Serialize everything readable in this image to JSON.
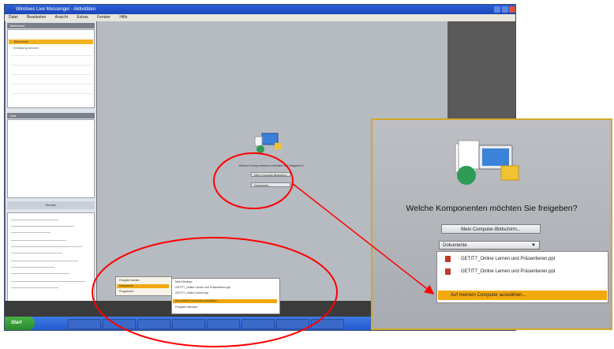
{
  "window": {
    "title": "Windows Live Messenger - Aktivitäten",
    "menu": [
      "Datei",
      "Bearbeiten",
      "Ansicht",
      "Extras",
      "Fenster",
      "Hilfe"
    ]
  },
  "left_panel": {
    "header": "Teilnehmer",
    "selected_item": "Teilnehmer",
    "item2": "Einladung senden",
    "header2": "Chat",
    "send_button": "Senden"
  },
  "stage": {
    "question": "Welche Komponenten möchten Sie freigeben?",
    "btn_desktop": "Mein Computer-Bildschirm...",
    "btn_docs": "Dokumente..."
  },
  "popups": {
    "menu1": [
      "Freigabe starten",
      "Dokumente",
      "Programme"
    ],
    "menu2": [
      "Mein Desktop",
      "GETIT7_Online Lernen und Präsentieren.ppt",
      "GETIT7_Online Lernen.ppt",
      "Auf meinem Computer auswählen...",
      "Freigabe beenden"
    ]
  },
  "zoom": {
    "question": "Welche Komponenten möchten Sie freigeben?",
    "desktop_button": "Mein Computer-Bildschirm...",
    "select_value": "Dokumente",
    "list": [
      "GETIT7_Online Lernen und Präsentieren.ppt",
      "GETIT7_Online Lernen und Präsentieren.ppt",
      "Auf meinem Computer auswählen..."
    ]
  },
  "taskbar": {
    "start": "Start"
  },
  "colors": {
    "annotation": "#ff0000",
    "highlight": "#f3a80d",
    "taskbar": "#245ad0",
    "start": "#2b8a2d"
  }
}
